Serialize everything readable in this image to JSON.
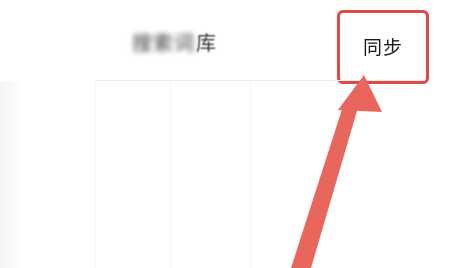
{
  "header": {
    "title_blurred": "搜索词",
    "title_visible": "库",
    "title_partial": "词库",
    "sync_label": "同步"
  },
  "annotation": {
    "highlight_color": "#e04a42",
    "arrow_color": "#e8665b"
  }
}
